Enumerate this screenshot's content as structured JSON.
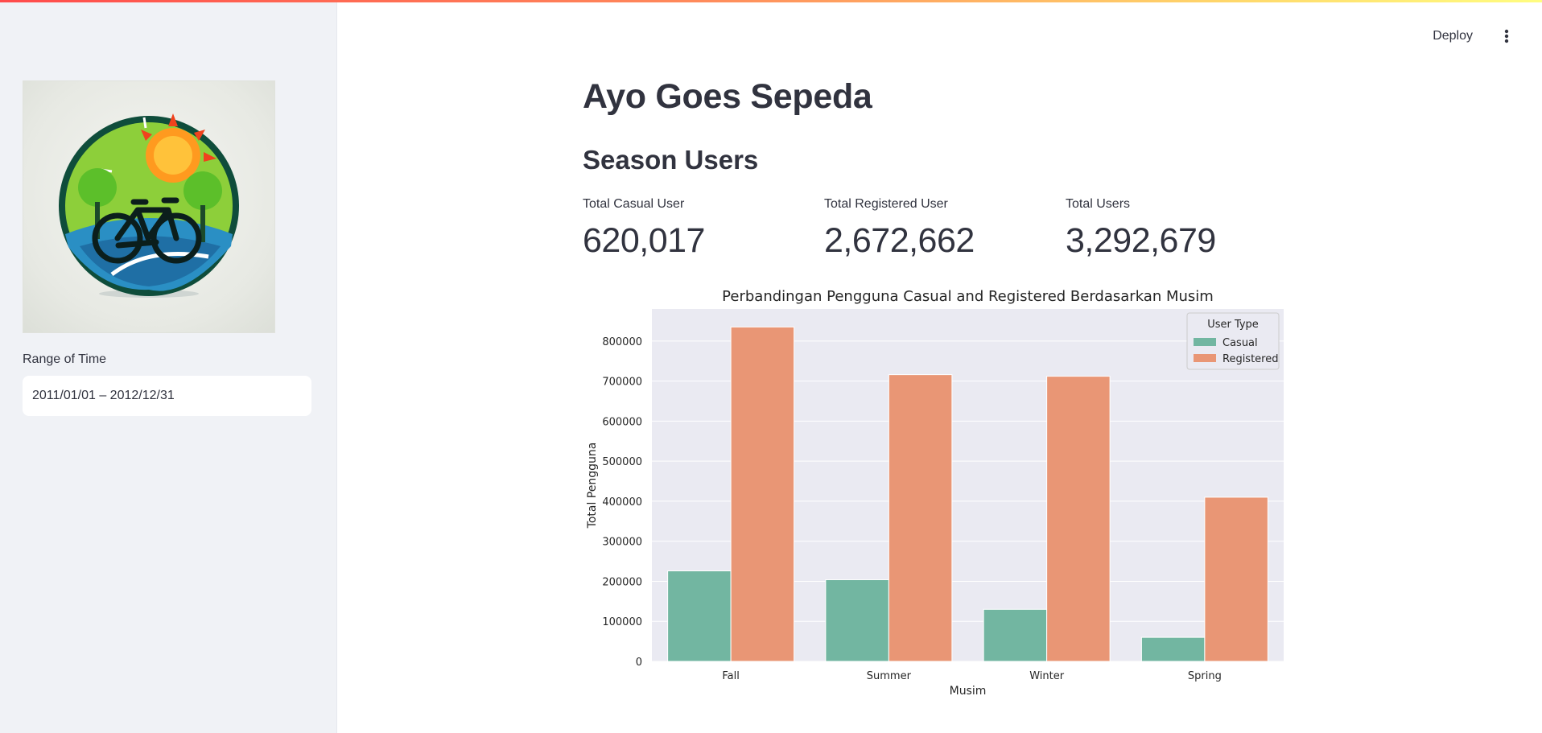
{
  "header": {
    "deploy_label": "Deploy",
    "menu_icon": "vertical-dots-icon"
  },
  "sidebar": {
    "logo_icon": "bicycle-sun-trees-logo",
    "date_range": {
      "label": "Range of Time",
      "value": "2011/01/01 – 2012/12/31"
    }
  },
  "main": {
    "title": "Ayo Goes Sepeda",
    "section_title": "Season Users",
    "metrics": [
      {
        "label": "Total Casual User",
        "value": "620,017"
      },
      {
        "label": "Total Registered User",
        "value": "2,672,662"
      },
      {
        "label": "Total Users",
        "value": "3,292,679"
      }
    ]
  },
  "chart_data": {
    "type": "bar",
    "title": "Perbandingan Pengguna Casual and Registered Berdasarkan Musim",
    "xlabel": "Musim",
    "ylabel": "Total Pengguna",
    "categories": [
      "Fall",
      "Summer",
      "Winter",
      "Spring"
    ],
    "series": [
      {
        "name": "Casual",
        "values": [
          226000,
          204000,
          130000,
          60000
        ],
        "color": "#72b6a1"
      },
      {
        "name": "Registered",
        "values": [
          835000,
          716000,
          712000,
          410000
        ],
        "color": "#e99675"
      }
    ],
    "ylim": [
      0,
      880000
    ],
    "yticks": [
      0,
      100000,
      200000,
      300000,
      400000,
      500000,
      600000,
      700000,
      800000
    ],
    "grid": true,
    "legend": {
      "title": "User Type",
      "position": "top-right"
    },
    "plot_background": "#eaeaf2"
  }
}
